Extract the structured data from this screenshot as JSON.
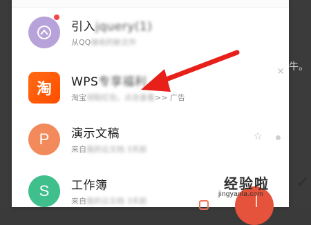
{
  "items": [
    {
      "title": "引入jquery(1)",
      "title_plain": "引入",
      "title_blur": "jquery(1)",
      "subtitle": "从QQ",
      "subtitle_blur": "接收的新文件"
    },
    {
      "title_plain": "WPS",
      "title_blur": "专享福利",
      "subtitle": "淘宝",
      "subtitle_blur": "领取红包，点击查看",
      "subtitle_tail": ">> 广告"
    },
    {
      "title": "演示文稿",
      "subtitle": "来自",
      "subtitle_blur": "我的云文档 3天前"
    },
    {
      "title": "工作簿",
      "subtitle": "来自",
      "subtitle_blur": "我的云文档 3天前"
    }
  ],
  "icons": {
    "row1": "cloud-upload-icon",
    "row2": "taobao-icon",
    "row2_glyph": "淘",
    "row3_glyph": "P",
    "row4_glyph": "S",
    "close": "close-icon",
    "star": "star-icon",
    "more": "dot-icon"
  },
  "colors": {
    "taobao": "#ff5a10",
    "presentation": "#f28a5b",
    "workbook": "#3fbf8c",
    "cloud": "#b7a2d9",
    "arrow": "#e8201a",
    "badge": "#f04848"
  },
  "back_page_glyph": "牛。",
  "watermark": {
    "name": "经验啦",
    "check": "✓",
    "url": "jingyanla.com"
  }
}
